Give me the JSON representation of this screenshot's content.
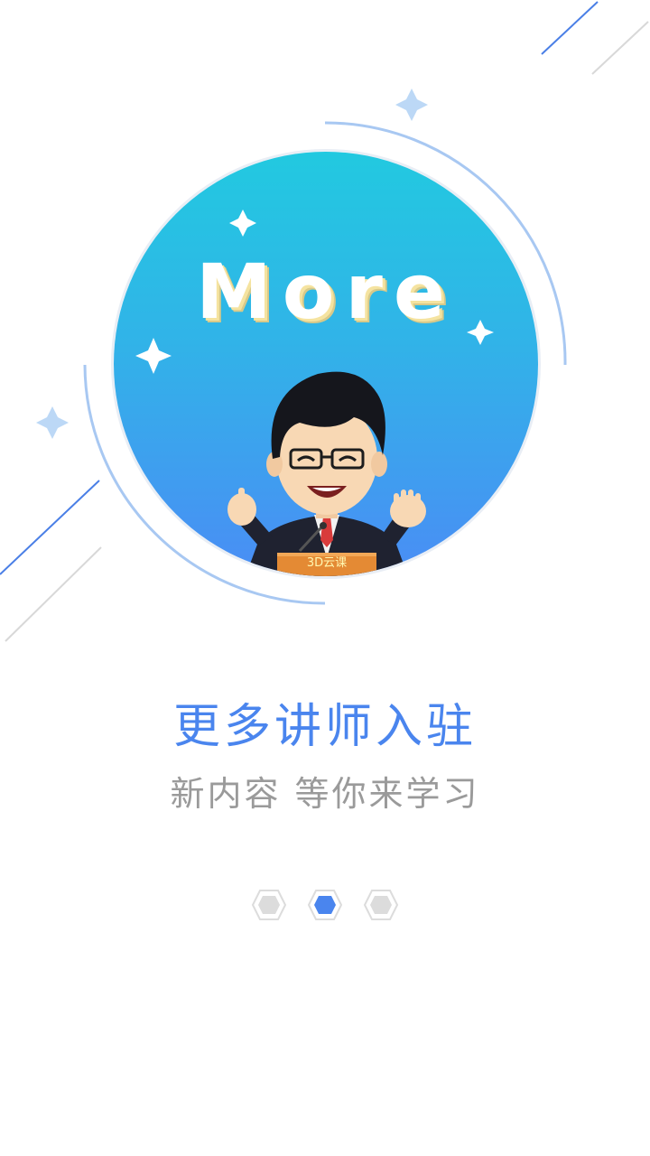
{
  "hero": {
    "badge_word": "More",
    "podium_label": "3D云课"
  },
  "main": {
    "headline": "更多讲师入驻",
    "subline": "新内容 等你来学习"
  },
  "pager": {
    "total_pages": 3,
    "current_page": 2
  },
  "colors": {
    "accent": "#4a85ee",
    "circle_top": "#22c9e0",
    "circle_bottom": "#4a8df5",
    "subtext": "#9a9a9a",
    "dot_inactive": "#dcdcdc"
  }
}
